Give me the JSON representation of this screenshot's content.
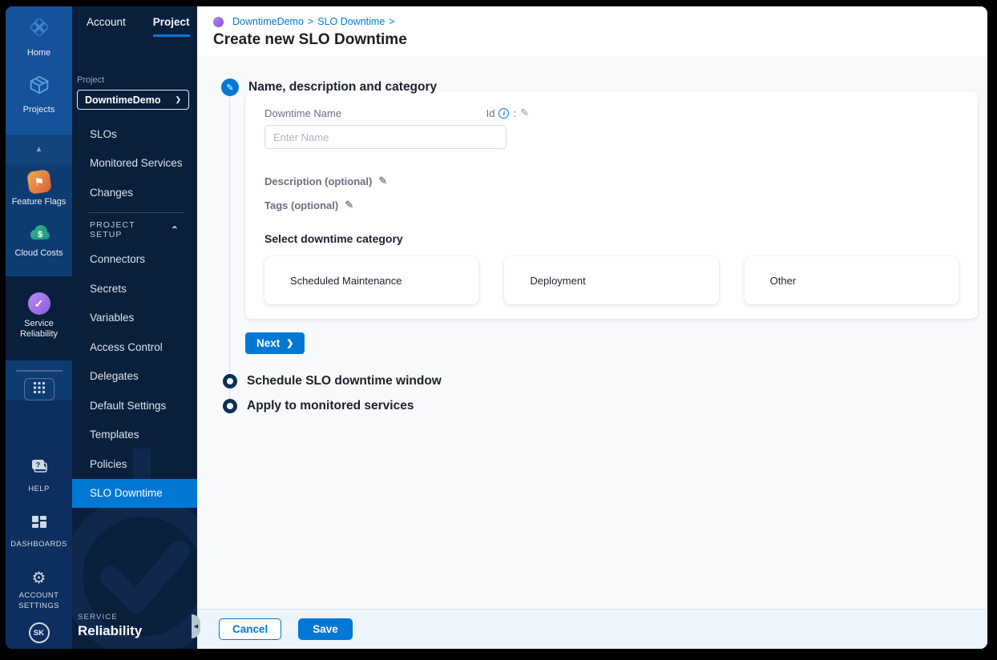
{
  "icons": {
    "chevron_right": "❯",
    "chevron_right_small": "❯",
    "pencil": "✎",
    "info": "i",
    "colon": ":",
    "chevron_up": "⌃",
    "up_arrow": "▲",
    "back_arrow": "◀",
    "gear": "⚙",
    "flag": "⚑",
    "dollar": "$",
    "check": "✓",
    "question": "?",
    "breadcrumb_sep": ">"
  },
  "rail": {
    "top": [
      "Home",
      "Projects"
    ],
    "mid": [
      "Feature Flags",
      "Cloud Costs"
    ],
    "selected_module": "Service Reliability",
    "bottom": [
      "HELP",
      "DASHBOARDS",
      "ACCOUNT SETTINGS"
    ],
    "avatar": "SK"
  },
  "panel": {
    "tabs": [
      "Account",
      "Project"
    ],
    "project_label": "Project",
    "project_selector": "DowntimeDemo",
    "nav_items": [
      "SLOs",
      "Monitored Services",
      "Changes"
    ],
    "section_header": "PROJECT SETUP",
    "setup_items": [
      "Connectors",
      "Secrets",
      "Variables",
      "Access Control",
      "Delegates",
      "Default Settings",
      "Templates",
      "Policies",
      "SLO Downtime"
    ],
    "module_footer": {
      "line1": "SERVICE",
      "line2": "Reliability"
    }
  },
  "header": {
    "breadcrumb": [
      "DowntimeDemo",
      "SLO Downtime"
    ],
    "title": "Create new SLO Downtime"
  },
  "wizard": {
    "step1": {
      "title": "Name, description and category",
      "name_label": "Downtime Name",
      "id_label": "Id",
      "name_placeholder": "Enter Name",
      "description_label": "Description (optional)",
      "tags_label": "Tags (optional)",
      "category_label": "Select downtime category",
      "categories": [
        "Scheduled Maintenance",
        "Deployment",
        "Other"
      ],
      "next_label": "Next"
    },
    "step2_title": "Schedule SLO downtime window",
    "step3_title": "Apply to monitored services"
  },
  "footer": {
    "cancel": "Cancel",
    "save": "Save"
  },
  "colors": {
    "accent": "#0278d5",
    "rail_top": "#16529a",
    "panel_bg": "#0a1f3c"
  }
}
